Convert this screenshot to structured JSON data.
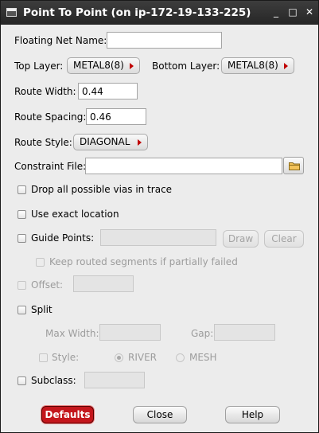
{
  "window": {
    "title": "Point To Point (on ip-172-19-133-225)",
    "min_glyph": "_",
    "max_glyph": "□",
    "close_glyph": "✕"
  },
  "form": {
    "floating_net": {
      "label": "Floating Net Name:",
      "value": ""
    },
    "top_layer": {
      "label": "Top Layer:",
      "value": "METAL8(8)"
    },
    "bottom_layer": {
      "label": "Bottom Layer:",
      "value": "METAL8(8)"
    },
    "route_width": {
      "label": "Route Width:",
      "value": "0.44"
    },
    "route_spacing": {
      "label": "Route Spacing:",
      "value": "0.46"
    },
    "route_style": {
      "label": "Route Style:",
      "value": "DIAGONAL"
    },
    "constraint_file": {
      "label": "Constraint File:",
      "value": ""
    },
    "drop_vias": {
      "label": "Drop all possible vias in trace",
      "checked": false
    },
    "exact_location": {
      "label": "Use exact location",
      "checked": false
    },
    "guide_points": {
      "label": "Guide Points:",
      "value": "",
      "draw_label": "Draw",
      "clear_label": "Clear"
    },
    "keep_routed": {
      "label": "Keep routed segments if partially failed",
      "checked": false
    },
    "offset": {
      "label": "Offset:",
      "value": ""
    },
    "split": {
      "label": "Split",
      "checked": false
    },
    "max_width": {
      "label": "Max Width:",
      "value": ""
    },
    "gap": {
      "label": "Gap:",
      "value": ""
    },
    "style": {
      "label": "Style:",
      "options": [
        "RIVER",
        "MESH"
      ],
      "selected": "RIVER"
    },
    "subclass": {
      "label": "Subclass:",
      "value": ""
    }
  },
  "buttons": {
    "defaults": "Defaults",
    "close": "Close",
    "help": "Help"
  },
  "colors": {
    "default_button": "#c4161c",
    "arrow": "#c00000",
    "titlebar": "#2f2f2f"
  }
}
